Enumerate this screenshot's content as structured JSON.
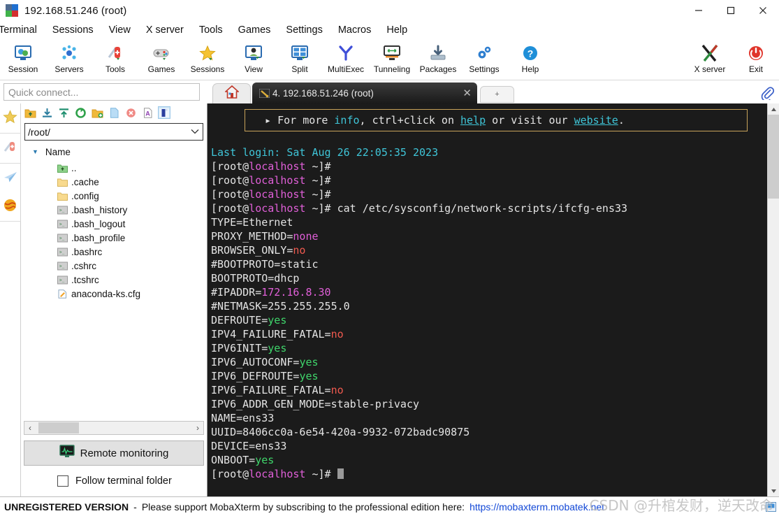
{
  "window": {
    "title": "192.168.51.246 (root)",
    "app_icon": "mobaxterm-logo-icon",
    "minimize": "—",
    "maximize": "□",
    "close": "✕"
  },
  "menubar": {
    "items": [
      {
        "label": "Terminal",
        "name": "menu-terminal"
      },
      {
        "label": "Sessions",
        "name": "menu-sessions"
      },
      {
        "label": "View",
        "name": "menu-view"
      },
      {
        "label": "X server",
        "name": "menu-x-server"
      },
      {
        "label": "Tools",
        "name": "menu-tools"
      },
      {
        "label": "Games",
        "name": "menu-games"
      },
      {
        "label": "Settings",
        "name": "menu-settings"
      },
      {
        "label": "Macros",
        "name": "menu-macros"
      },
      {
        "label": "Help",
        "name": "menu-help"
      }
    ]
  },
  "toolbar": {
    "items": [
      {
        "label": "Session",
        "icon": "session-icon"
      },
      {
        "label": "Servers",
        "icon": "servers-icon"
      },
      {
        "label": "Tools",
        "icon": "tools-knife-icon"
      },
      {
        "label": "Games",
        "icon": "gamepad-icon"
      },
      {
        "label": "Sessions",
        "icon": "star-icon"
      },
      {
        "label": "View",
        "icon": "view-monitor-icon"
      },
      {
        "label": "Split",
        "icon": "split-grid-icon"
      },
      {
        "label": "MultiExec",
        "icon": "multiexec-fork-icon"
      },
      {
        "label": "Tunneling",
        "icon": "tunneling-icon"
      },
      {
        "label": "Packages",
        "icon": "packages-download-icon"
      },
      {
        "label": "Settings",
        "icon": "gear-icon"
      },
      {
        "label": "Help",
        "icon": "help-question-icon"
      }
    ],
    "right_items": [
      {
        "label": "X server",
        "icon": "x-server-icon"
      },
      {
        "label": "Exit",
        "icon": "power-exit-icon"
      }
    ]
  },
  "quick_connect": {
    "placeholder": "Quick connect...",
    "value": ""
  },
  "tabs": {
    "home_icon": "home-icon",
    "active": {
      "icon": "terminal-tab-icon",
      "label": "4. 192.168.51.246 (root)",
      "close": "✕"
    },
    "new_tab": "+",
    "clip_icon": "paperclip-icon"
  },
  "left_rail": {
    "items": [
      {
        "name": "rail-favorites",
        "icon": "star-icon"
      },
      {
        "name": "rail-tools",
        "icon": "tools-knife-icon"
      },
      {
        "name": "rail-sftp-send",
        "icon": "paper-plane-icon"
      },
      {
        "name": "rail-globe",
        "icon": "globe-icon"
      }
    ]
  },
  "sftp": {
    "tool_icons": [
      {
        "name": "parent-folder-icon",
        "glyph": "up-folder"
      },
      {
        "name": "download-icon",
        "glyph": "download"
      },
      {
        "name": "upload-icon",
        "glyph": "upload"
      },
      {
        "name": "refresh-icon",
        "glyph": "refresh"
      },
      {
        "name": "new-folder-icon",
        "glyph": "newfolder"
      },
      {
        "name": "new-file-icon",
        "glyph": "newfile"
      },
      {
        "name": "delete-icon",
        "glyph": "delete"
      },
      {
        "name": "text-mode-icon",
        "glyph": "textmode"
      },
      {
        "name": "binary-mode-icon",
        "glyph": "binmode"
      }
    ],
    "path": "/root/",
    "path_dropdown": "∨",
    "column_header": "Name",
    "sort_caret": "▼",
    "files": [
      {
        "name": "..",
        "icon": "parent-dir-icon"
      },
      {
        "name": ".cache",
        "icon": "folder-icon"
      },
      {
        "name": ".config",
        "icon": "folder-icon"
      },
      {
        "name": ".bash_history",
        "icon": "script-file-icon"
      },
      {
        "name": ".bash_logout",
        "icon": "script-file-icon"
      },
      {
        "name": ".bash_profile",
        "icon": "script-file-icon"
      },
      {
        "name": ".bashrc",
        "icon": "script-file-icon"
      },
      {
        "name": ".cshrc",
        "icon": "script-file-icon"
      },
      {
        "name": ".tcshrc",
        "icon": "script-file-icon"
      },
      {
        "name": "anaconda-ks.cfg",
        "icon": "config-file-icon"
      }
    ],
    "hscroll": {
      "left": "‹",
      "right": "›"
    },
    "remote_monitoring": {
      "label": "Remote monitoring",
      "icon": "monitor-graph-icon"
    },
    "follow_terminal": {
      "label": "Follow terminal folder",
      "checked": false
    }
  },
  "terminal": {
    "banner": [
      {
        "t": "  ▸ For more ",
        "c": "white"
      },
      {
        "t": "info",
        "c": "cyan"
      },
      {
        "t": ", ctrl+click on ",
        "c": "white"
      },
      {
        "t": "help",
        "c": "link"
      },
      {
        "t": " or visit our ",
        "c": "white"
      },
      {
        "t": "website",
        "c": "link"
      },
      {
        "t": ".",
        "c": "white"
      }
    ],
    "lines": [
      [
        {
          "t": "Last login: Sat Aug 26 22:05:35 2023",
          "c": "cyan"
        }
      ],
      [
        {
          "t": "[root@",
          "c": "white"
        },
        {
          "t": "localhost",
          "c": "magenta"
        },
        {
          "t": " ~]#",
          "c": "white"
        }
      ],
      [
        {
          "t": "[root@",
          "c": "white"
        },
        {
          "t": "localhost",
          "c": "magenta"
        },
        {
          "t": " ~]#",
          "c": "white"
        }
      ],
      [
        {
          "t": "[root@",
          "c": "white"
        },
        {
          "t": "localhost",
          "c": "magenta"
        },
        {
          "t": " ~]#",
          "c": "white"
        }
      ],
      [
        {
          "t": "[root@",
          "c": "white"
        },
        {
          "t": "localhost",
          "c": "magenta"
        },
        {
          "t": " ~]# cat /etc/sysconfig/network-scripts/ifcfg-ens33",
          "c": "white"
        }
      ],
      [
        {
          "t": "TYPE=Ethernet",
          "c": "white"
        }
      ],
      [
        {
          "t": "PROXY_METHOD=",
          "c": "white"
        },
        {
          "t": "none",
          "c": "magenta"
        }
      ],
      [
        {
          "t": "BROWSER_ONLY=",
          "c": "white"
        },
        {
          "t": "no",
          "c": "red"
        }
      ],
      [
        {
          "t": "#BOOTPROTO=static",
          "c": "white"
        }
      ],
      [
        {
          "t": "BOOTPROTO=dhcp",
          "c": "white"
        }
      ],
      [
        {
          "t": "#IPADDR=",
          "c": "white"
        },
        {
          "t": "172.16.8.30",
          "c": "magenta"
        }
      ],
      [
        {
          "t": "#NETMASK=255.255.255.0",
          "c": "white"
        }
      ],
      [
        {
          "t": "DEFROUTE=",
          "c": "white"
        },
        {
          "t": "yes",
          "c": "green"
        }
      ],
      [
        {
          "t": "IPV4_FAILURE_FATAL=",
          "c": "white"
        },
        {
          "t": "no",
          "c": "red"
        }
      ],
      [
        {
          "t": "IPV6INIT=",
          "c": "white"
        },
        {
          "t": "yes",
          "c": "green"
        }
      ],
      [
        {
          "t": "IPV6_AUTOCONF=",
          "c": "white"
        },
        {
          "t": "yes",
          "c": "green"
        }
      ],
      [
        {
          "t": "IPV6_DEFROUTE=",
          "c": "white"
        },
        {
          "t": "yes",
          "c": "green"
        }
      ],
      [
        {
          "t": "IPV6_FAILURE_FATAL=",
          "c": "white"
        },
        {
          "t": "no",
          "c": "red"
        }
      ],
      [
        {
          "t": "IPV6_ADDR_GEN_MODE=stable-privacy",
          "c": "white"
        }
      ],
      [
        {
          "t": "NAME=ens33",
          "c": "white"
        }
      ],
      [
        {
          "t": "UUID=8406cc0a-6e54-420a-9932-072badc90875",
          "c": "white"
        }
      ],
      [
        {
          "t": "DEVICE=ens33",
          "c": "white"
        }
      ],
      [
        {
          "t": "ONBOOT=",
          "c": "white"
        },
        {
          "t": "yes",
          "c": "green"
        }
      ],
      [
        {
          "t": "[root@",
          "c": "white"
        },
        {
          "t": "localhost",
          "c": "magenta"
        },
        {
          "t": " ~]# ",
          "c": "white"
        },
        {
          "t": "",
          "c": "cursor"
        }
      ]
    ]
  },
  "status_bar": {
    "bold": "UNREGISTERED VERSION",
    "dash": "-",
    "text": "Please support MobaXterm by subscribing to the professional edition here:",
    "link": "https://mobaxterm.mobatek.net"
  },
  "watermark": "CSDN @升棺发财，逆天改命",
  "colors": {
    "term_bg": "#1b1b1b",
    "cyan": "#3fc5d8",
    "magenta": "#e05fd8",
    "green": "#3fd66b",
    "red": "#f05a4f",
    "white": "#e4e4e4",
    "link_blue": "#1147d6",
    "banner_border": "#c8a35a"
  }
}
